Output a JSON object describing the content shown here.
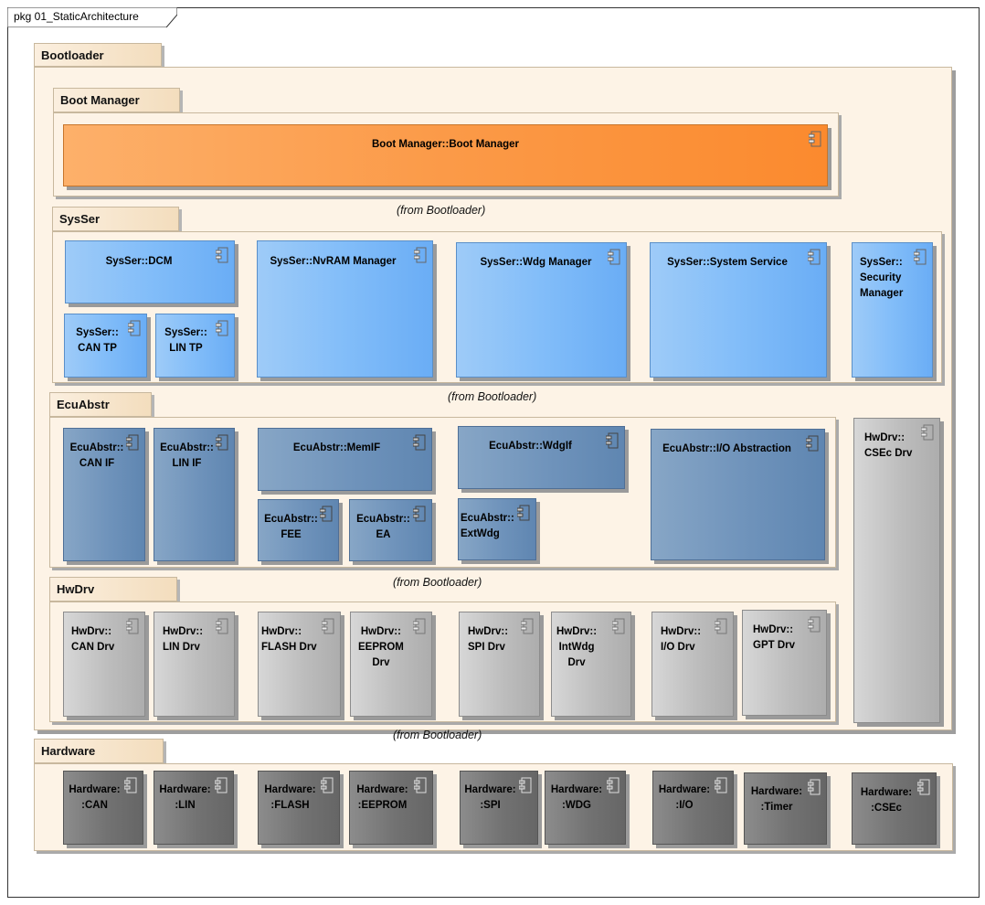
{
  "frame": {
    "title": "pkg 01_StaticArchitecture"
  },
  "from_note": "(from Bootloader)",
  "packages": {
    "bootloader": "Bootloader",
    "boot_manager": "Boot Manager",
    "sysser": "SysSer",
    "ecuabstr": "EcuAbstr",
    "hwdrv": "HwDrv",
    "hardware": "Hardware"
  },
  "components": {
    "boot_manager": "Boot Manager::Boot Manager",
    "dcm": "SysSer::DCM",
    "can_tp": "SysSer::\nCAN TP",
    "lin_tp": "SysSer::\nLIN TP",
    "nvram": "SysSer::NvRAM Manager",
    "wdg_manager": "SysSer::Wdg Manager",
    "system_service": "SysSer::System Service",
    "security_manager": "SysSer::\nSecurity\nManager",
    "can_if": "EcuAbstr::\nCAN IF",
    "lin_if": "EcuAbstr::\nLIN IF",
    "memif": "EcuAbstr::MemIF",
    "fee": "EcuAbstr::\nFEE",
    "ea": "EcuAbstr::\nEA",
    "wdgif": "EcuAbstr::WdgIf",
    "extwdg": "EcuAbstr::\nExtWdg",
    "io_abstraction": "EcuAbstr::I/O Abstraction",
    "csec_drv": "HwDrv::\nCSEc Drv",
    "can_drv": "HwDrv::\nCAN Drv",
    "lin_drv": "HwDrv::\nLIN Drv",
    "flash_drv": "HwDrv::\nFLASH Drv",
    "eeprom_drv": "HwDrv::\nEEPROM\nDrv",
    "spi_drv": "HwDrv::\nSPI Drv",
    "intwdg_drv": "HwDrv::\nIntWdg\nDrv",
    "io_drv": "HwDrv::\nI/O Drv",
    "gpt_drv": "HwDrv::\nGPT Drv",
    "hw_can": "Hardware:\n:CAN",
    "hw_lin": "Hardware:\n:LIN",
    "hw_flash": "Hardware:\n:FLASH",
    "hw_eeprom": "Hardware:\n:EEPROM",
    "hw_spi": "Hardware:\n:SPI",
    "hw_wdg": "Hardware:\n:WDG",
    "hw_io": "Hardware:\n:I/O",
    "hw_timer": "Hardware:\n:Timer",
    "hw_csec": "Hardware:\n:CSEc"
  },
  "colors": {
    "package_fill": "#fdf3e6",
    "boot_manager": "#fb9a48",
    "sysser": "#82bdf9",
    "ecuabstr": "#6f93bb",
    "hwdrv": "#bdbdbd",
    "hardware": "#727272"
  },
  "icons": {
    "component": "component-icon"
  }
}
